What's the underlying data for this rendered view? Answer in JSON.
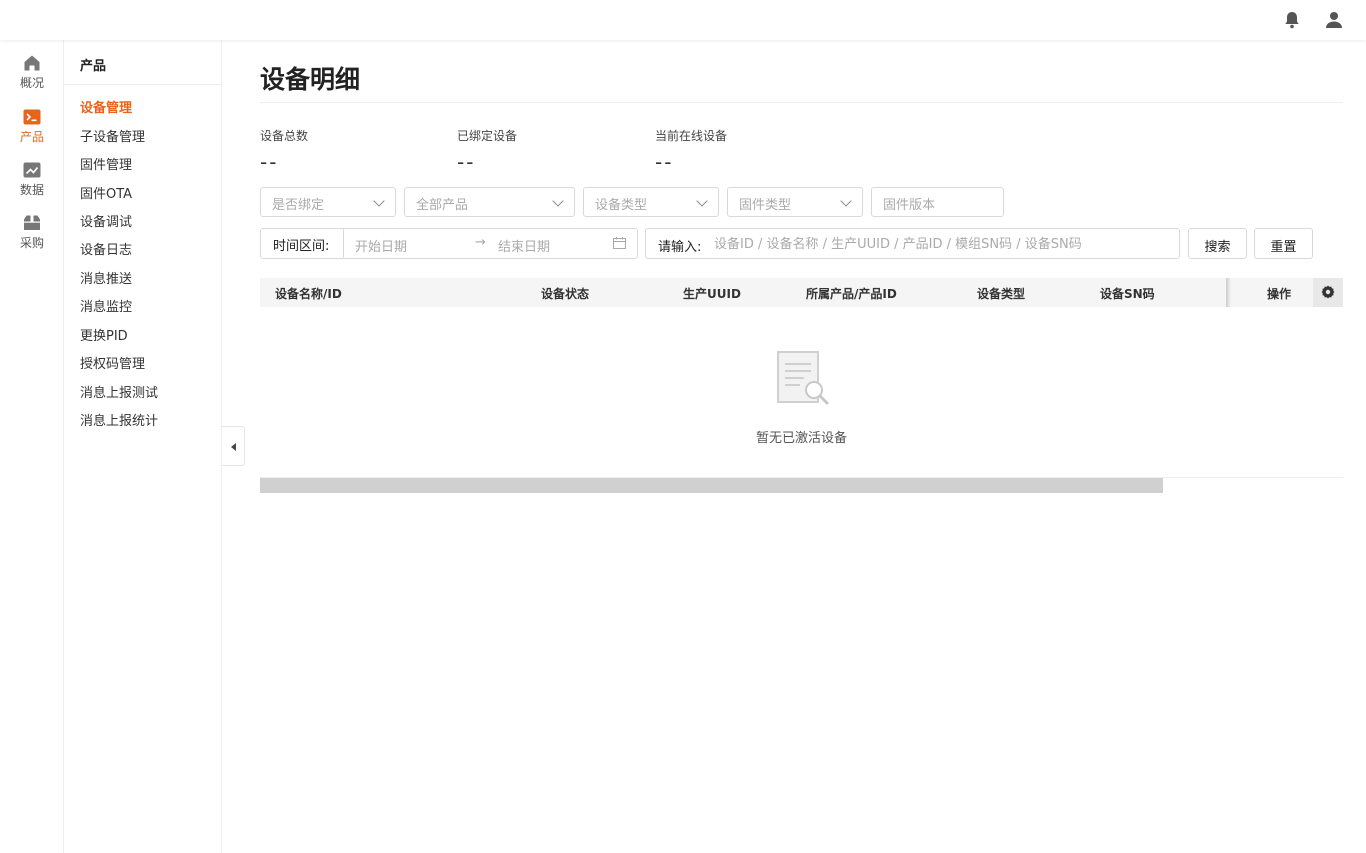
{
  "topbar": {
    "icons": [
      "bell-icon",
      "user-icon"
    ]
  },
  "rail": {
    "items": [
      {
        "label": "概况",
        "icon": "home-icon",
        "active": false
      },
      {
        "label": "产品",
        "icon": "terminal-icon",
        "active": true
      },
      {
        "label": "数据",
        "icon": "chart-icon",
        "active": false
      },
      {
        "label": "采购",
        "icon": "box-icon",
        "active": false
      }
    ],
    "accent": "#e8641b"
  },
  "subnav": {
    "title": "产品",
    "items": [
      "设备管理",
      "子设备管理",
      "固件管理",
      "固件OTA",
      "设备调试",
      "设备日志",
      "消息推送",
      "消息监控",
      "更换PID",
      "授权码管理",
      "消息上报测试",
      "消息上报统计"
    ],
    "active_index": 0
  },
  "page": {
    "title": "设备明细"
  },
  "stats": [
    {
      "label": "设备总数",
      "value": "--"
    },
    {
      "label": "已绑定设备",
      "value": "--"
    },
    {
      "label": "当前在线设备",
      "value": "--"
    }
  ],
  "filters": {
    "selects": [
      "是否绑定",
      "全部产品",
      "设备类型",
      "固件类型"
    ],
    "firmware_version_placeholder": "固件版本",
    "time_range_label": "时间区间:",
    "start_placeholder": "开始日期",
    "range_arrow": "→",
    "end_placeholder": "结束日期",
    "search_label": "请输入:",
    "search_placeholder": "设备ID / 设备名称 / 生产UUID / 产品ID / 模组SN码 / 设备SN码",
    "search_button": "搜索",
    "reset_button": "重置"
  },
  "table": {
    "columns": [
      "设备名称/ID",
      "设备状态",
      "生产UUID",
      "所属产品/产品ID",
      "设备类型",
      "设备SN码",
      "操作"
    ],
    "rows": [],
    "empty_text": "暂无已激活设备"
  }
}
